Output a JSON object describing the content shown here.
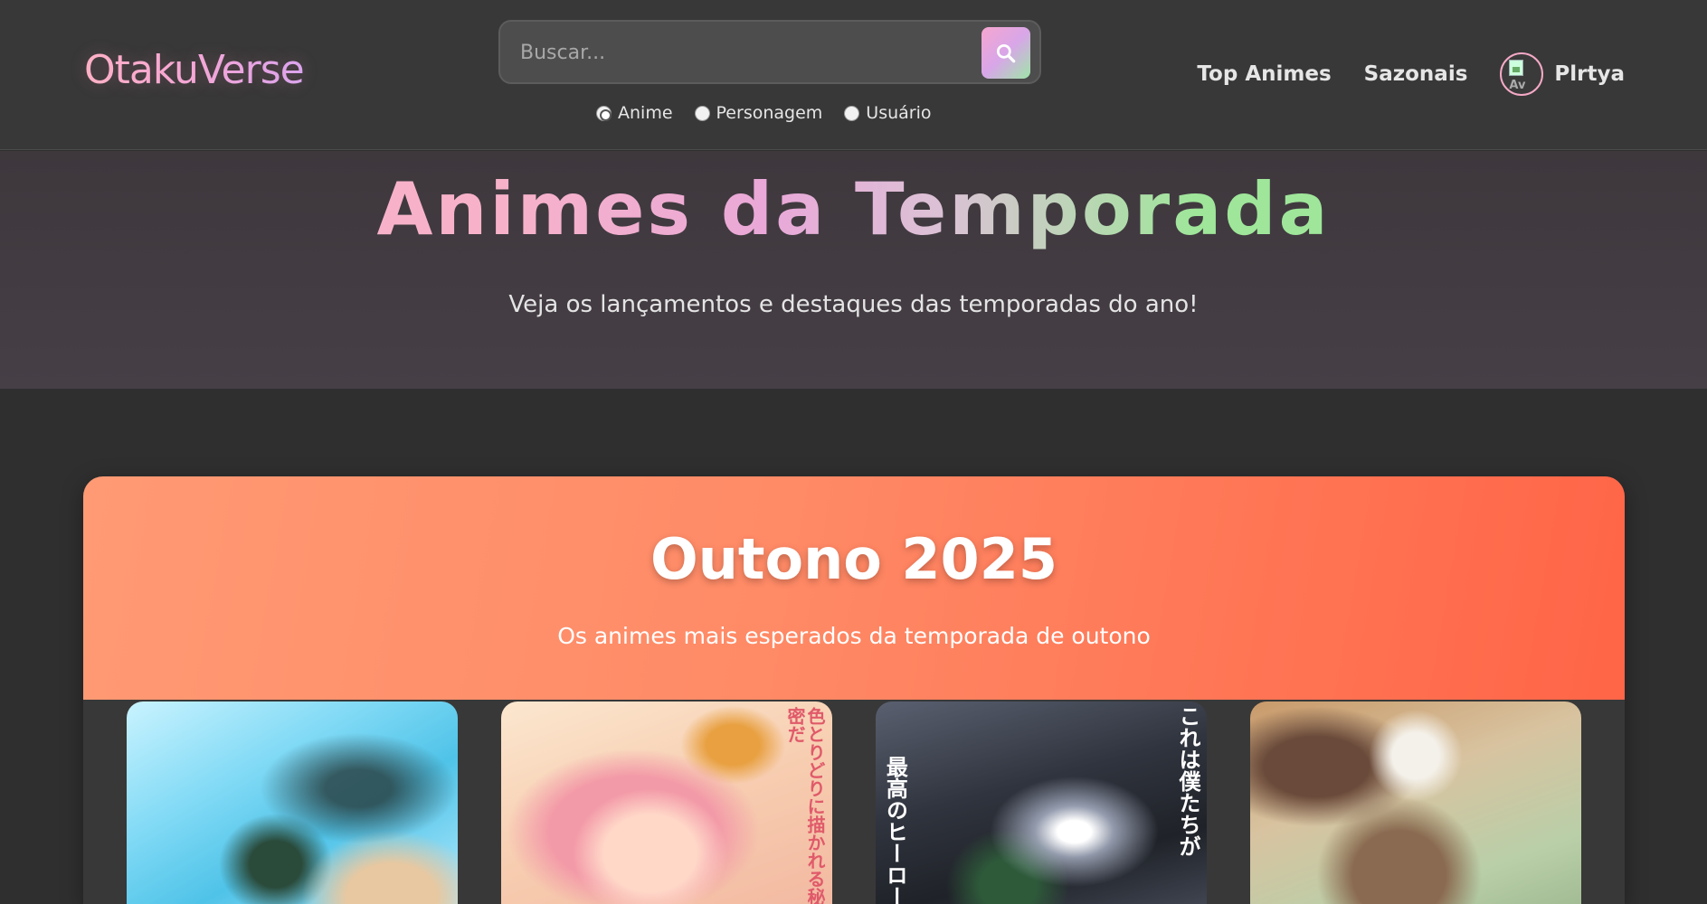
{
  "header": {
    "logo": "OtakuVerse",
    "search": {
      "placeholder": "Buscar...",
      "value": "",
      "options": [
        "Anime",
        "Personagem",
        "Usuário"
      ],
      "selected": "Anime"
    },
    "nav": {
      "top_animes": "Top Animes",
      "sazonais": "Sazonais"
    },
    "user": {
      "name": "Plrtya",
      "avatar_alt": "Av"
    }
  },
  "hero": {
    "title": "Animes da Temporada",
    "subtitle": "Veja os lançamentos e destaques das temporadas do ano!"
  },
  "season": {
    "title": "Outono 2025",
    "subtitle": "Os animes mais esperados da temporada de outono",
    "posters": [
      {
        "text": ""
      },
      {
        "text": "色とりどりに描かれる秘密だ"
      },
      {
        "text": "これは僕たちが",
        "text2": "最高のヒーロー"
      },
      {
        "text": ""
      }
    ]
  },
  "colors": {
    "page_bg": "#2f2f2f",
    "header_bg": "#383838",
    "season_accent": "#ff7a5a",
    "logo_pink": "#ffb3c6",
    "title_green": "#9fe69a"
  }
}
